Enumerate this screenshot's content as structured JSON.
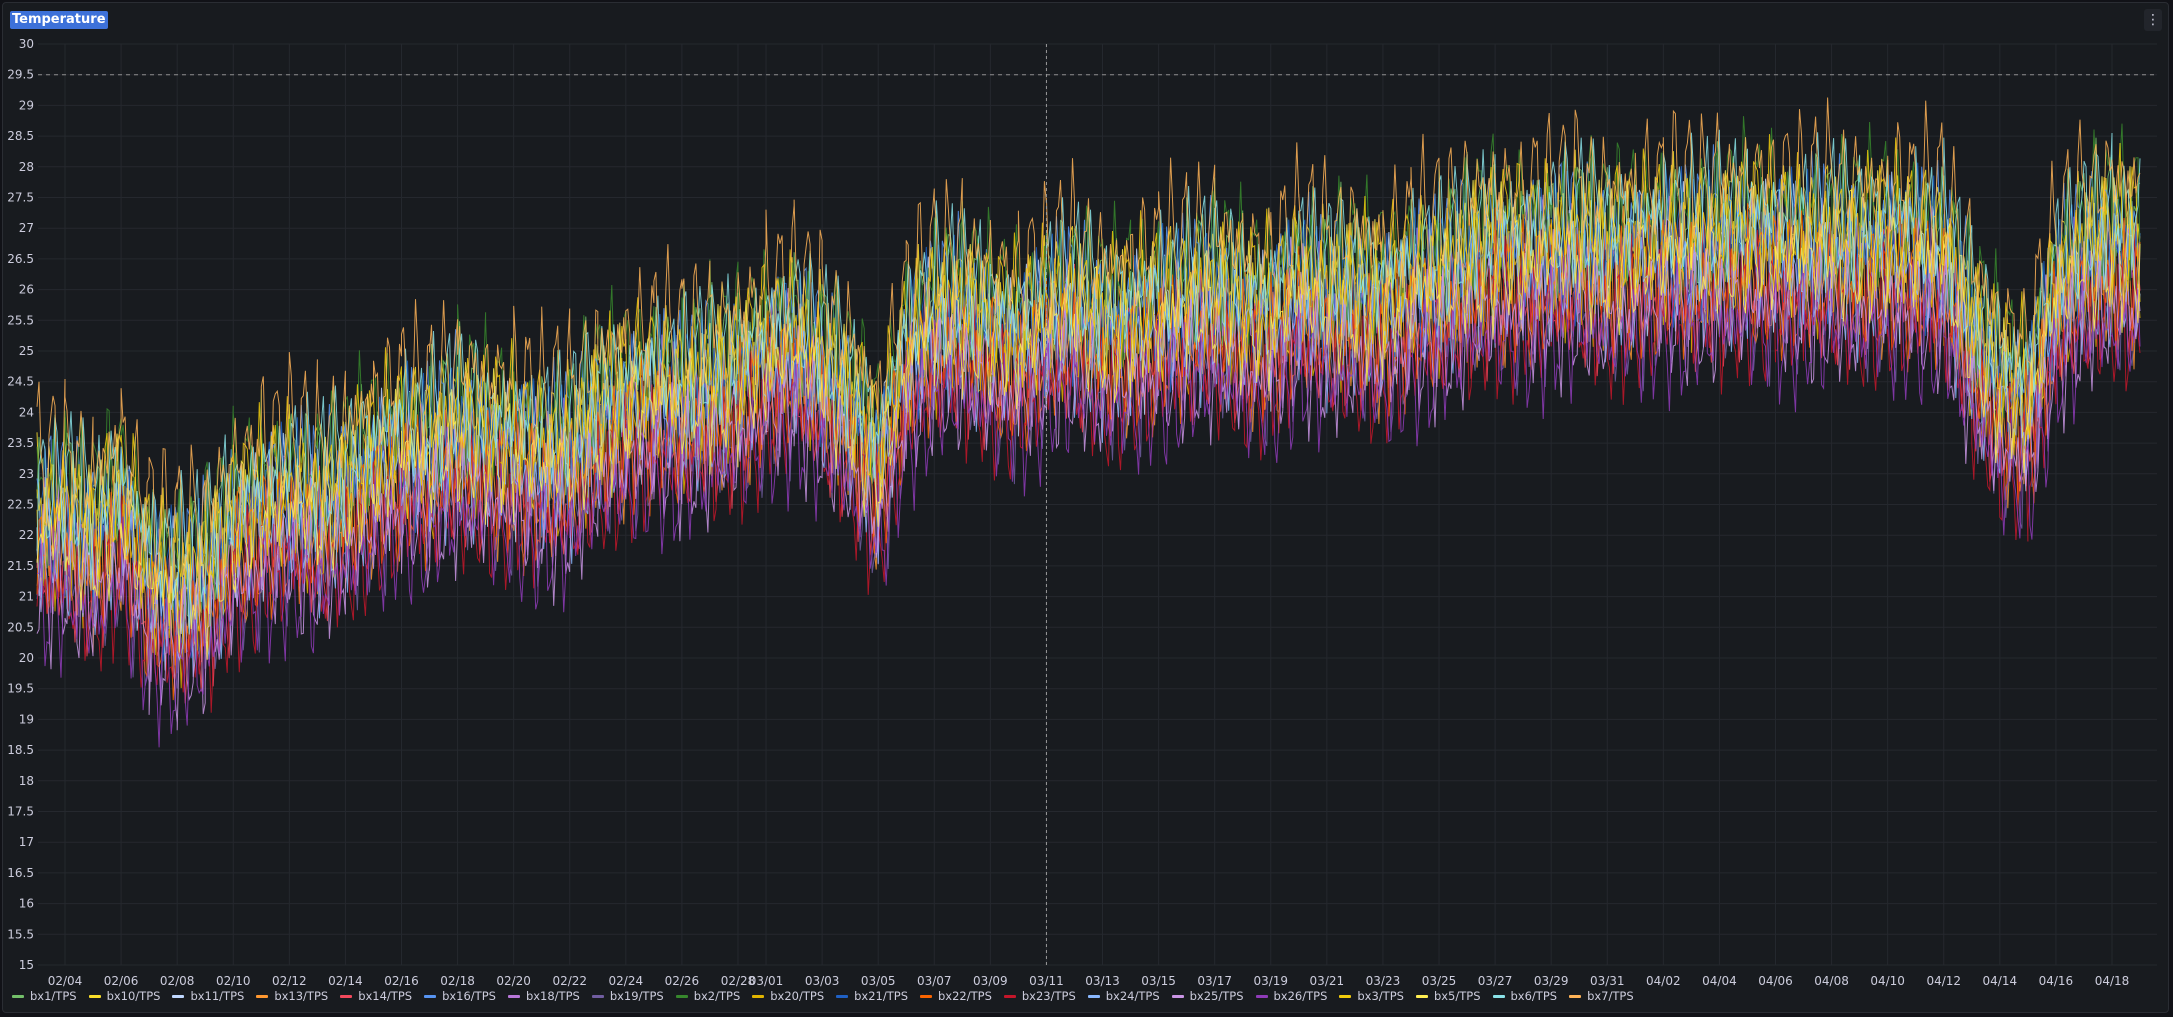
{
  "panel": {
    "title": "Temperature",
    "menu_icon": "⋮"
  },
  "chart_data": {
    "type": "line",
    "title": "Temperature",
    "ylim": [
      15,
      30
    ],
    "y_ticks": [
      "15",
      "15.5",
      "16",
      "16.5",
      "17",
      "17.5",
      "18",
      "18.5",
      "19",
      "19.5",
      "20",
      "20.5",
      "21",
      "21.5",
      "22",
      "22.5",
      "23",
      "23.5",
      "24",
      "24.5",
      "25",
      "25.5",
      "26",
      "26.5",
      "27",
      "27.5",
      "28",
      "28.5",
      "29",
      "29.5",
      "30"
    ],
    "x_ticks": [
      "02/04",
      "02/06",
      "02/08",
      "02/10",
      "02/12",
      "02/14",
      "02/16",
      "02/18",
      "02/20",
      "02/22",
      "02/24",
      "02/26",
      "02/28",
      "03/01",
      "03/03",
      "03/05",
      "03/07",
      "03/09",
      "03/11",
      "03/13",
      "03/15",
      "03/17",
      "03/19",
      "03/21",
      "03/23",
      "03/25",
      "03/27",
      "03/29",
      "03/31",
      "04/02",
      "04/04",
      "04/06",
      "04/08",
      "04/10",
      "04/12",
      "04/14",
      "04/16",
      "04/18"
    ],
    "threshold": 29.5,
    "cursor_date": "03/11",
    "grid": true,
    "legend_position": "bottom",
    "x_points": [
      "02/03",
      "02/04",
      "02/05",
      "02/06",
      "02/07",
      "02/08",
      "02/09",
      "02/10",
      "02/11",
      "02/12",
      "02/13",
      "02/14",
      "02/15",
      "02/16",
      "02/17",
      "02/18",
      "02/19",
      "02/20",
      "02/21",
      "02/22",
      "02/23",
      "02/24",
      "02/25",
      "02/26",
      "02/27",
      "02/28",
      "03/01",
      "03/02",
      "03/03",
      "03/04",
      "03/05",
      "03/06",
      "03/07",
      "03/08",
      "03/09",
      "03/10",
      "03/11",
      "03/12",
      "03/13",
      "03/14",
      "03/15",
      "03/16",
      "03/17",
      "03/18",
      "03/19",
      "03/20",
      "03/21",
      "03/22",
      "03/23",
      "03/24",
      "03/25",
      "03/26",
      "03/27",
      "03/28",
      "03/29",
      "03/30",
      "03/31",
      "04/01",
      "04/02",
      "04/03",
      "04/04",
      "04/05",
      "04/06",
      "04/07",
      "04/08",
      "04/09",
      "04/10",
      "04/11",
      "04/12",
      "04/13",
      "04/14",
      "04/15",
      "04/16",
      "04/17",
      "04/18",
      "04/19"
    ],
    "base_profile": [
      22.0,
      22.2,
      21.8,
      22.4,
      21.2,
      21.0,
      21.2,
      22.0,
      22.3,
      22.5,
      22.3,
      22.6,
      23.0,
      23.3,
      23.2,
      23.6,
      23.4,
      23.3,
      23.1,
      23.2,
      23.8,
      24.0,
      24.2,
      24.1,
      24.3,
      24.4,
      24.8,
      25.0,
      24.6,
      24.0,
      23.0,
      24.8,
      25.4,
      25.5,
      25.2,
      25.0,
      25.4,
      25.6,
      25.2,
      25.3,
      25.5,
      25.6,
      25.8,
      25.5,
      25.4,
      25.9,
      25.7,
      25.8,
      25.6,
      25.9,
      26.0,
      26.3,
      26.5,
      26.4,
      26.5,
      26.6,
      26.4,
      26.5,
      26.6,
      26.5,
      26.6,
      26.7,
      26.6,
      26.5,
      26.6,
      26.5,
      26.6,
      26.5,
      26.4,
      25.2,
      24.3,
      24.0,
      25.8,
      26.4,
      26.6,
      26.5
    ],
    "series": [
      {
        "name": "bx1/TPS",
        "color": "#73bf69",
        "offset": 0.6
      },
      {
        "name": "bx10/TPS",
        "color": "#fade2a",
        "offset": 0.3
      },
      {
        "name": "bx11/TPS",
        "color": "#c0d8ff",
        "offset": 0.0
      },
      {
        "name": "bx13/TPS",
        "color": "#ff9830",
        "offset": -0.4
      },
      {
        "name": "bx14/TPS",
        "color": "#f2495c",
        "offset": -0.6
      },
      {
        "name": "bx16/TPS",
        "color": "#5794f2",
        "offset": 0.4
      },
      {
        "name": "bx18/TPS",
        "color": "#b877d9",
        "offset": -0.2
      },
      {
        "name": "bx19/TPS",
        "color": "#705da0",
        "offset": -0.8
      },
      {
        "name": "bx2/TPS",
        "color": "#37872d",
        "offset": 0.8
      },
      {
        "name": "bx20/TPS",
        "color": "#e0b400",
        "offset": -0.1
      },
      {
        "name": "bx21/TPS",
        "color": "#1f60c4",
        "offset": 0.2
      },
      {
        "name": "bx22/TPS",
        "color": "#fa6400",
        "offset": -0.5
      },
      {
        "name": "bx23/TPS",
        "color": "#c4162a",
        "offset": -1.0
      },
      {
        "name": "bx24/TPS",
        "color": "#8ab8ff",
        "offset": -0.3
      },
      {
        "name": "bx25/TPS",
        "color": "#ca95e5",
        "offset": -0.9
      },
      {
        "name": "bx26/TPS",
        "color": "#8f3bb8",
        "offset": -1.2
      },
      {
        "name": "bx3/TPS",
        "color": "#f2cc0c",
        "offset": 0.5
      },
      {
        "name": "bx5/TPS",
        "color": "#ffee52",
        "offset": 0.1
      },
      {
        "name": "bx6/TPS",
        "color": "#8ae2e8",
        "offset": 0.7
      },
      {
        "name": "bx7/TPS",
        "color": "#ffb357",
        "offset": 1.2
      }
    ]
  }
}
